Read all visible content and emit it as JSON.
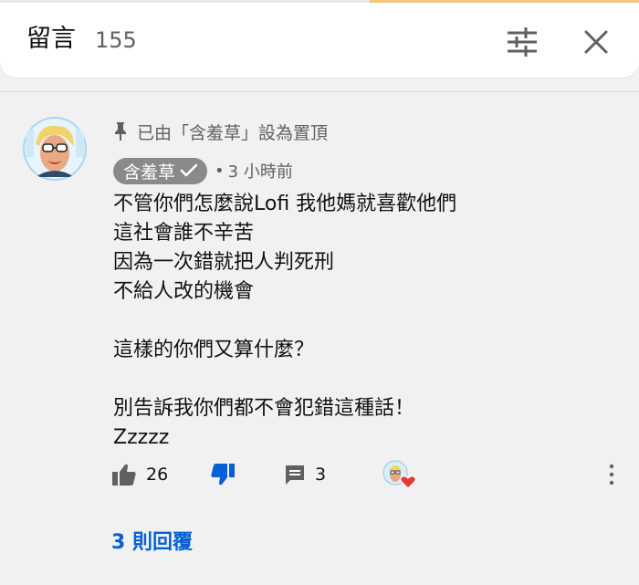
{
  "header": {
    "title": "留言",
    "count": "155"
  },
  "comment": {
    "pinned_text": "已由「含羞草」設為置頂",
    "author": "含羞草",
    "dot": "•",
    "time": "3 小時前",
    "body": "不管你們怎麼說Lofi 我他媽就喜歡他們\n這社會誰不辛苦\n因為一次錯就把人判死刑\n不給人改的機會\n\n這樣的你們又算什麼？\n\n別告訴我你們都不會犯錯這種話！\nZzzzz",
    "likes": "26",
    "reply_count": "3",
    "replies_link": "3 則回覆"
  },
  "colors": {
    "accent_blue": "#065fd4",
    "heart_red": "#e53935",
    "chip_gray": "#8a8a8a",
    "background": "#f1f1f1"
  },
  "icons": [
    "sliders-icon",
    "close-icon",
    "pin-icon",
    "verified-check-icon",
    "thumbs-up-icon",
    "thumbs-down-icon",
    "reply-icon",
    "heart-icon",
    "more-vert-icon"
  ]
}
